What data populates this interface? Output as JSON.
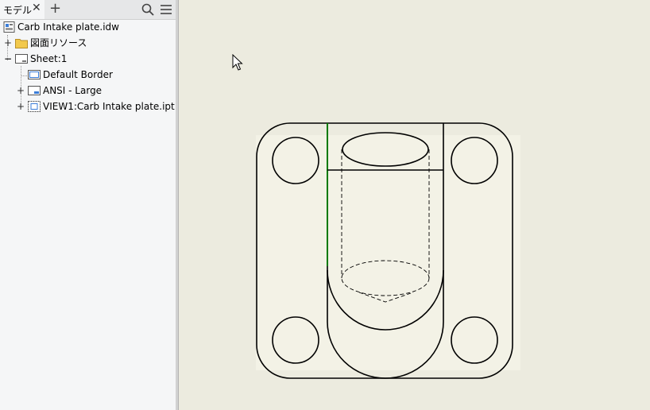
{
  "browser": {
    "tab_label": "モデル",
    "close_symbol": "✕",
    "add_symbol": "+",
    "tree": [
      {
        "label": "Carb Intake plate.idw",
        "icon": "drawing-document-icon"
      },
      {
        "label": "図面リソース",
        "icon": "folder-icon",
        "expander": "+"
      },
      {
        "label": "Sheet:1",
        "icon": "sheet-icon",
        "expander": "−"
      },
      {
        "label": "Default Border",
        "icon": "border-icon"
      },
      {
        "label": "ANSI - Large",
        "icon": "title-block-icon",
        "expander": "+"
      },
      {
        "label": "VIEW1:Carb Intake plate.ipt",
        "icon": "drawing-view-icon",
        "expander": "+"
      }
    ]
  },
  "colors": {
    "canvas": "#ecebdf",
    "panel": "#f5f6f7",
    "highlight_edge": "#007a00",
    "geometry": "#000000"
  }
}
